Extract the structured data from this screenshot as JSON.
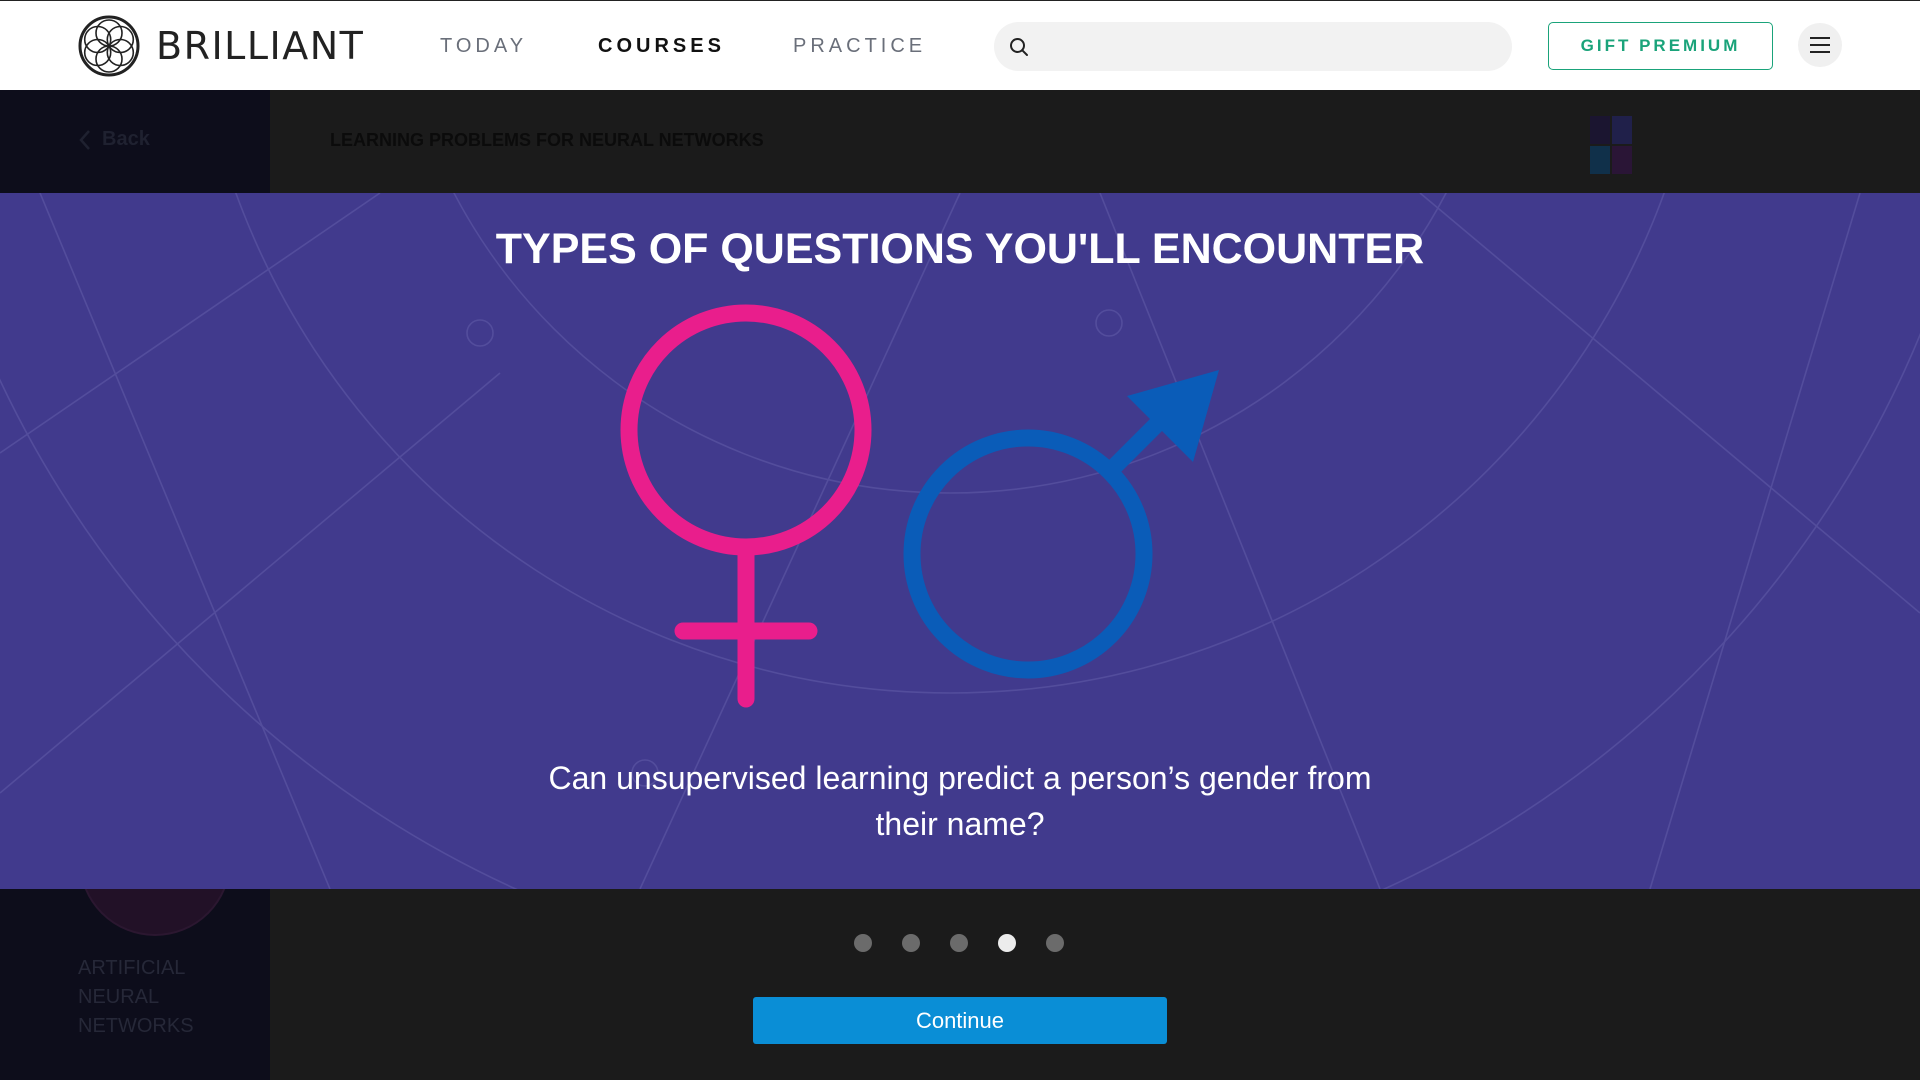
{
  "brand": {
    "name": "BRILLIANT"
  },
  "nav": {
    "items": [
      {
        "label": "TODAY"
      },
      {
        "label": "COURSES"
      },
      {
        "label": "PRACTICE"
      }
    ],
    "active": "COURSES"
  },
  "search": {
    "placeholder": "",
    "value": ""
  },
  "header_actions": {
    "gift_label": "GIFT PREMIUM",
    "menu_icon": "hamburger-icon"
  },
  "course": {
    "back_label": "Back",
    "title": "LEARNING PROBLEMS FOR NEURAL NETWORKS",
    "sidebar_label": "ARTIFICIAL NEURAL NETWORKS"
  },
  "modal": {
    "title": "TYPES OF QUESTIONS YOU'LL ENCOUNTER",
    "question": "Can unsupervised learning predict a person’s gender from their name?",
    "icons": [
      "female-symbol-icon",
      "male-symbol-icon"
    ]
  },
  "pager": {
    "total": 5,
    "current": 4
  },
  "continue_label": "Continue",
  "colors": {
    "panel_bg": "#413a8d",
    "female_symbol": "#e91e8c",
    "male_symbol": "#0a5cb8",
    "continue_bg": "#0a8ed6",
    "gift_accent": "#1aa37a"
  }
}
